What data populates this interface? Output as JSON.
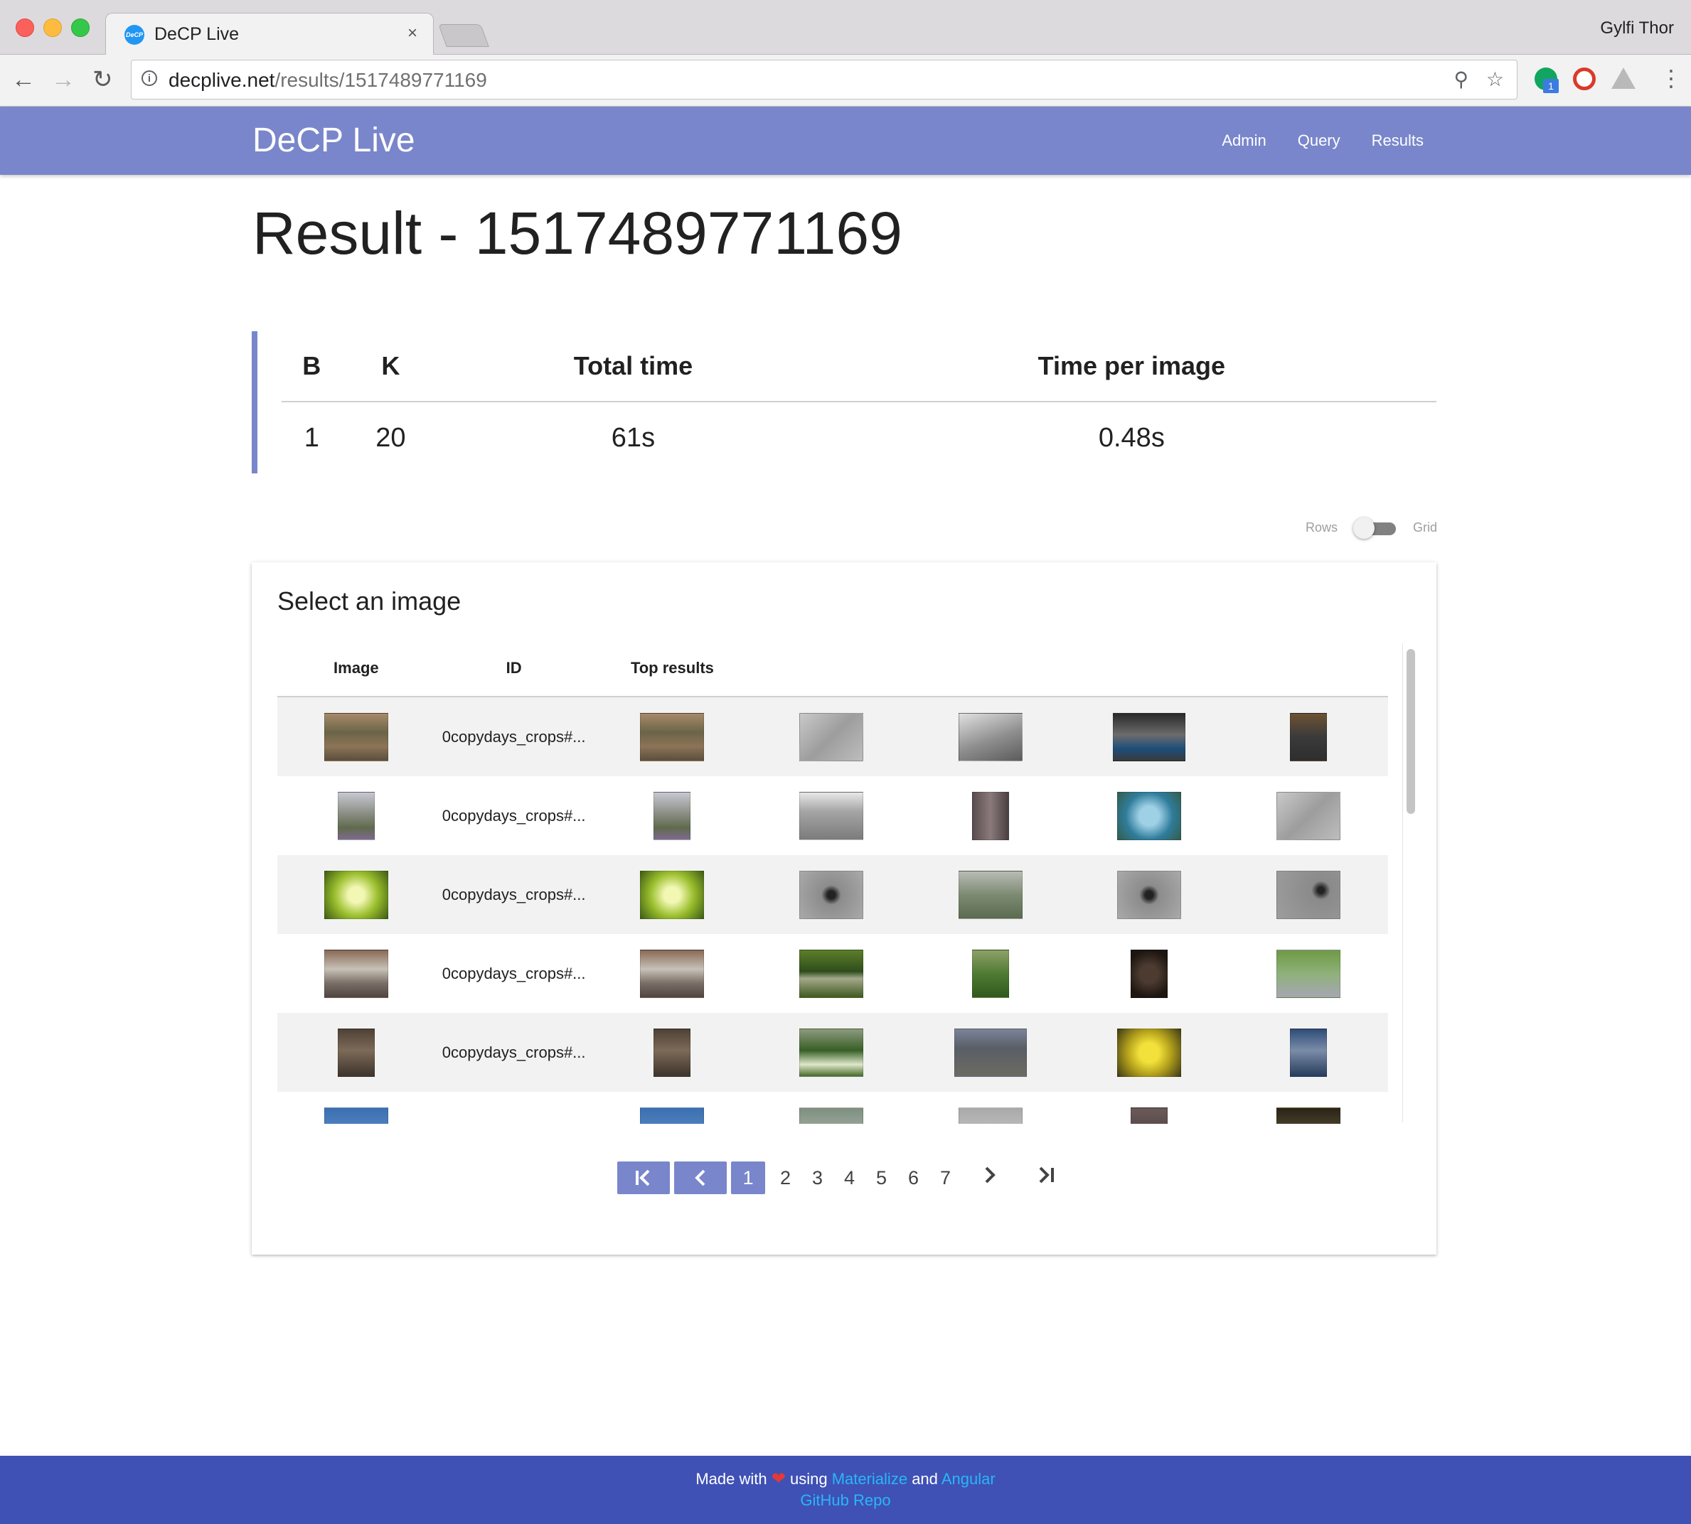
{
  "browser": {
    "tab_title": "DeCP Live",
    "tab_favicon_text": "DeCP",
    "tab_close": "×",
    "profile_name": "Gylfi Thor",
    "url_host": "decplive.net",
    "url_path": "/results/1517489771169"
  },
  "app": {
    "brand": "DeCP Live",
    "nav": [
      "Admin",
      "Query",
      "Results"
    ]
  },
  "page": {
    "title": "Result - 1517489771169"
  },
  "stats": {
    "headers": [
      "B",
      "K",
      "Total time",
      "Time per image"
    ],
    "values": [
      "1",
      "20",
      "61s",
      "0.48s"
    ]
  },
  "view_toggle": {
    "left_label": "Rows",
    "right_label": "Grid",
    "state": "Rows"
  },
  "results": {
    "card_title": "Select an image",
    "columns": [
      "Image",
      "ID",
      "Top results"
    ],
    "rows": [
      {
        "id": "0copydays_crops#...",
        "image": "cactus-field",
        "top_results": [
          "cactus-field",
          "white-tiled-wall",
          "glass-atrium",
          "building-overhang",
          "doorway-silhouette"
        ]
      },
      {
        "id": "0copydays_crops#...",
        "image": "church-facade",
        "top_results": [
          "church-facade",
          "white-overhang",
          "brick-column",
          "pool-from-above",
          "white-tiled-wall"
        ]
      },
      {
        "id": "0copydays_crops#...",
        "image": "green-foliage",
        "top_results": [
          "green-foliage",
          "figure-on-wall",
          "fence-cityscape",
          "figure-on-wall",
          "bird-on-wall"
        ]
      },
      {
        "id": "0copydays_crops#...",
        "image": "street-market",
        "top_results": [
          "street-market",
          "park-bridge",
          "tree-trunk",
          "dark-leather",
          "riverbank"
        ]
      },
      {
        "id": "0copydays_crops#...",
        "image": "ruined-room",
        "top_results": [
          "ruined-room",
          "forest-path",
          "city-aerial",
          "yellow-flowers",
          "blue-mosaic"
        ]
      },
      {
        "id": "",
        "image": "blue-sky",
        "top_results": [
          "blue-sky",
          "building-facade",
          "grey-roof",
          "stone-wall",
          "dark-arch"
        ]
      }
    ]
  },
  "pagination": {
    "first_icon": "first-page-icon",
    "prev_icon": "chevron-left-icon",
    "next_icon": "chevron-right-icon",
    "last_icon": "last-page-icon",
    "current": "1",
    "pages": [
      "2",
      "3",
      "4",
      "5",
      "6",
      "7"
    ]
  },
  "footer": {
    "made_with": "Made with",
    "using": "using",
    "link1": "Materialize",
    "and": "and",
    "link2": "Angular",
    "repo": "GitHub Repo"
  }
}
